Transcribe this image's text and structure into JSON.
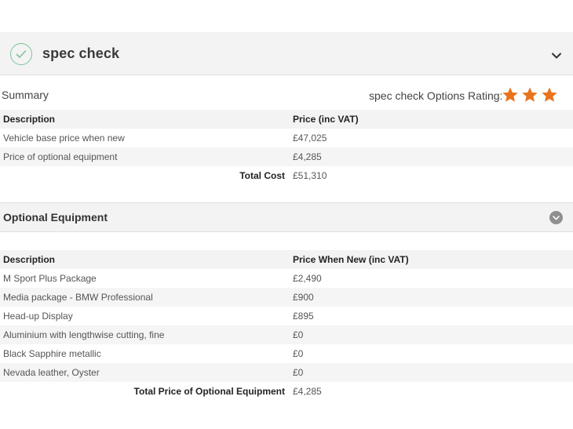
{
  "spec_check": {
    "title": "spec check",
    "icons": {
      "status": "check-circle-icon",
      "collapse": "chevron-down-icon"
    },
    "accent_color": "#7ec39a"
  },
  "summary": {
    "label": "Summary",
    "rating_label": "spec check Options Rating:",
    "rating_stars": 3,
    "star_color": "#e8731c",
    "headers": {
      "description": "Description",
      "price": "Price (inc VAT)"
    },
    "rows": [
      {
        "description": "Vehicle base price when new",
        "price": "£47,025"
      },
      {
        "description": "Price of optional equipment",
        "price": "£4,285"
      }
    ],
    "total": {
      "label": "Total Cost",
      "value": "£51,310"
    }
  },
  "optional_equipment": {
    "title": "Optional Equipment",
    "headers": {
      "description": "Description",
      "price": "Price When New (inc VAT)"
    },
    "rows": [
      {
        "description": "M Sport Plus Package",
        "price": "£2,490"
      },
      {
        "description": "Media package - BMW Professional",
        "price": "£900"
      },
      {
        "description": "Head-up Display",
        "price": "£895"
      },
      {
        "description": "Aluminium with lengthwise cutting, fine",
        "price": "£0"
      },
      {
        "description": "Black Sapphire metallic",
        "price": "£0"
      },
      {
        "description": "Nevada leather, Oyster",
        "price": "£0"
      }
    ],
    "total": {
      "label": "Total Price of Optional Equipment",
      "value": "£4,285"
    }
  }
}
